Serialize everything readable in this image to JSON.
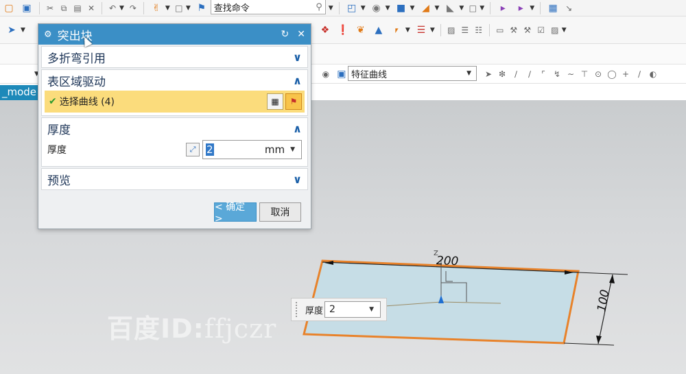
{
  "toolbar": {
    "command_search_placeholder": "查找命令",
    "curve_rule_value": "特征曲线"
  },
  "part_tab": {
    "label": "_mode"
  },
  "dialog": {
    "title": "突出块",
    "sections": {
      "bend_ref": {
        "title": "多折弯引用",
        "expanded": false
      },
      "region": {
        "title": "表区域驱动",
        "expanded": true,
        "select_label": "选择曲线 (4)"
      },
      "thickness": {
        "title": "厚度",
        "expanded": true,
        "field_label": "厚度",
        "value": "2",
        "unit": "mm"
      },
      "preview": {
        "title": "预览",
        "expanded": false
      }
    },
    "ok_label": "< 确定 >",
    "cancel_label": "取消"
  },
  "viewport": {
    "dim_length": "200",
    "dim_width": "100",
    "floating_thickness_label": "厚度",
    "floating_thickness_value": "2",
    "axis_label": "Z"
  },
  "watermark": {
    "prefix": "百度ID:",
    "user": "ffjczr"
  },
  "colors": {
    "dialog_title_bg": "#3b8fc6",
    "selection_row_bg": "#fbdc7c",
    "sheet_face": "#c6dde6",
    "sheet_edge": "#e8822a"
  }
}
